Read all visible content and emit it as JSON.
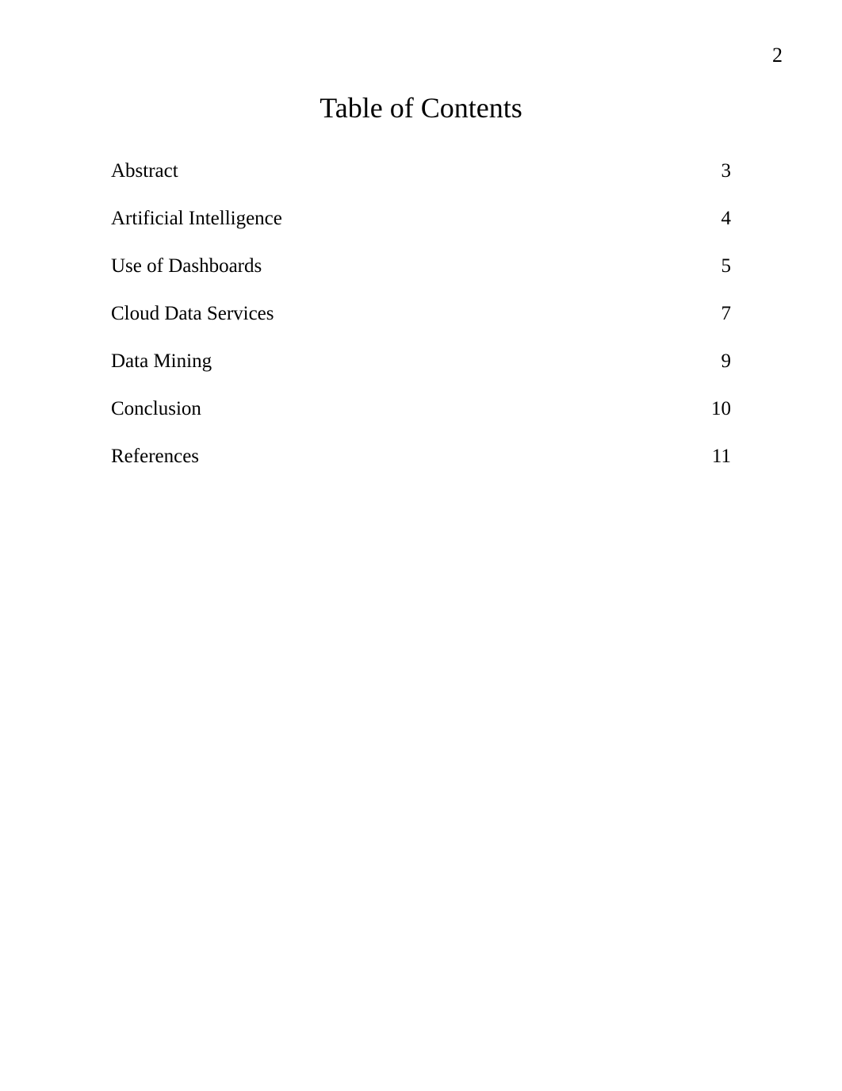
{
  "page_number": "2",
  "title": "Table of Contents",
  "toc": {
    "entries": [
      {
        "label": "Abstract",
        "page": "3"
      },
      {
        "label": "Artificial Intelligence",
        "page": "4"
      },
      {
        "label": "Use of Dashboards",
        "page": "5"
      },
      {
        "label": "Cloud Data Services",
        "page": "7"
      },
      {
        "label": "Data Mining",
        "page": "9"
      },
      {
        "label": "Conclusion",
        "page": "10"
      },
      {
        "label": "References",
        "page": "11"
      }
    ]
  }
}
